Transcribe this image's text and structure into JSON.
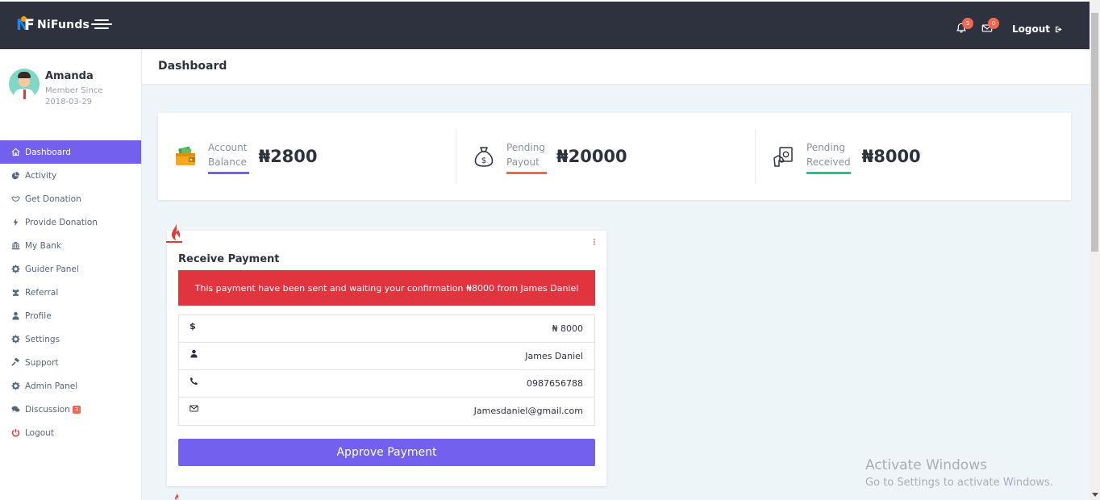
{
  "app": {
    "brand": "NiFunds",
    "brand_logo_letters": "NF"
  },
  "topbar": {
    "notifications_count": "5",
    "messages_count": "0",
    "logout_label": "Logout"
  },
  "user": {
    "name": "Amanda",
    "member_since_label": "Member Since",
    "member_since_date": "2018-03-29"
  },
  "sidebar": {
    "items": [
      {
        "label": "Dashboard",
        "icon": "home-icon",
        "active": true
      },
      {
        "label": "Activity",
        "icon": "pie-chart-icon"
      },
      {
        "label": "Get Donation",
        "icon": "handshake-icon"
      },
      {
        "label": "Provide Donation",
        "icon": "bolt-icon"
      },
      {
        "label": "My Bank",
        "icon": "bank-icon"
      },
      {
        "label": "Guider Panel",
        "icon": "gear-icon"
      },
      {
        "label": "Referral",
        "icon": "users-icon"
      },
      {
        "label": "Profile",
        "icon": "user-icon"
      },
      {
        "label": "Settings",
        "icon": "gear-icon"
      },
      {
        "label": "Support",
        "icon": "gavel-icon"
      },
      {
        "label": "Admin Panel",
        "icon": "gear-icon"
      },
      {
        "label": "Discussion",
        "icon": "comments-icon",
        "badge": "3"
      },
      {
        "label": "Logout",
        "icon": "power-icon",
        "color": "#e53935"
      }
    ]
  },
  "page": {
    "title": "Dashboard"
  },
  "stats": [
    {
      "label_line1": "Account",
      "label_line2": "Balance",
      "value": "₦2800",
      "icon": "wallet-icon",
      "underline_color": "#7460ee"
    },
    {
      "label_line1": "Pending",
      "label_line2": "Payout",
      "value": "₦20000",
      "icon": "money-bag-icon",
      "underline_color": "#f3674e"
    },
    {
      "label_line1": "Pending",
      "label_line2": "Received",
      "value": "₦8000",
      "icon": "cash-hand-icon",
      "underline_color": "#26c281"
    }
  ],
  "payment": {
    "title": "Receive Payment",
    "alert": "This payment have been sent and waiting your confirmation ₦8000 from James Daniel",
    "amount": "₦ 8000",
    "name": "James Daniel",
    "phone": "0987656788",
    "email": "Jamesdaniel@gmail.com",
    "approve_label": "Approve Payment"
  },
  "watermark": {
    "line1": "Activate Windows",
    "line2": "Go to Settings to activate Windows."
  },
  "colors": {
    "topbar": "#2d323e",
    "accent": "#7460ee",
    "alert": "#e0353f",
    "badge": "#f3674e"
  }
}
